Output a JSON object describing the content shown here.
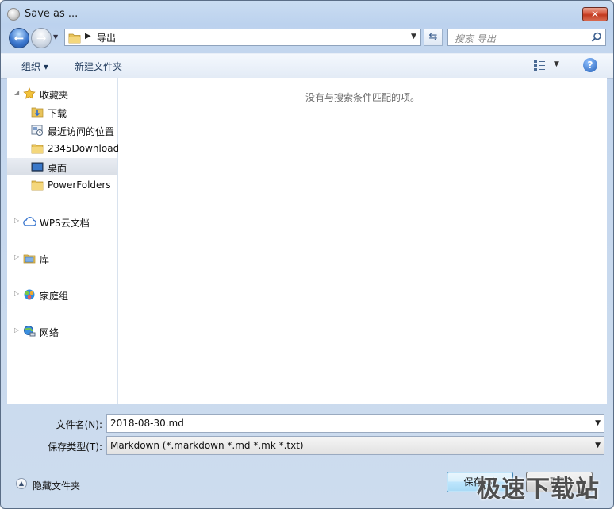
{
  "window": {
    "title": "Save as ...",
    "close_glyph": "✕"
  },
  "nav": {
    "back_glyph": "←",
    "forward_glyph": "→",
    "address": {
      "crumb": "导出"
    },
    "search": {
      "placeholder": "搜索 导出"
    }
  },
  "toolbar": {
    "organize_label": "组织 ▾",
    "new_folder_label": "新建文件夹",
    "help_glyph": "?"
  },
  "sidebar": {
    "items": [
      {
        "label": "收藏夹",
        "icon": "star-icon"
      },
      {
        "label": "下载",
        "icon": "download-folder-icon"
      },
      {
        "label": "最近访问的位置",
        "icon": "recent-places-icon"
      },
      {
        "label": "2345Download",
        "icon": "folder-icon"
      },
      {
        "label": "桌面",
        "icon": "desktop-icon",
        "selected": true
      },
      {
        "label": "PowerFolders",
        "icon": "folder-icon"
      },
      {
        "label": "WPS云文档",
        "icon": "cloud-icon"
      },
      {
        "label": "库",
        "icon": "library-icon"
      },
      {
        "label": "家庭组",
        "icon": "homegroup-icon"
      },
      {
        "label": "网络",
        "icon": "network-icon"
      }
    ]
  },
  "content": {
    "empty_message": "没有与搜索条件匹配的项。"
  },
  "form": {
    "filename_label": "文件名(N):",
    "filename_value": "2018-08-30.md",
    "filetype_label": "保存类型(T):",
    "filetype_value": "Markdown (*.markdown *.md *.mk *.txt)"
  },
  "footer": {
    "hide_folders_label": "隐藏文件夹",
    "save_label": "保存(S)",
    "cancel_label": "取消"
  },
  "watermark": "极速下载站",
  "colors": {
    "frame": "#c3d6ee",
    "accent_blue": "#2460b8",
    "close_red": "#c23a20"
  }
}
